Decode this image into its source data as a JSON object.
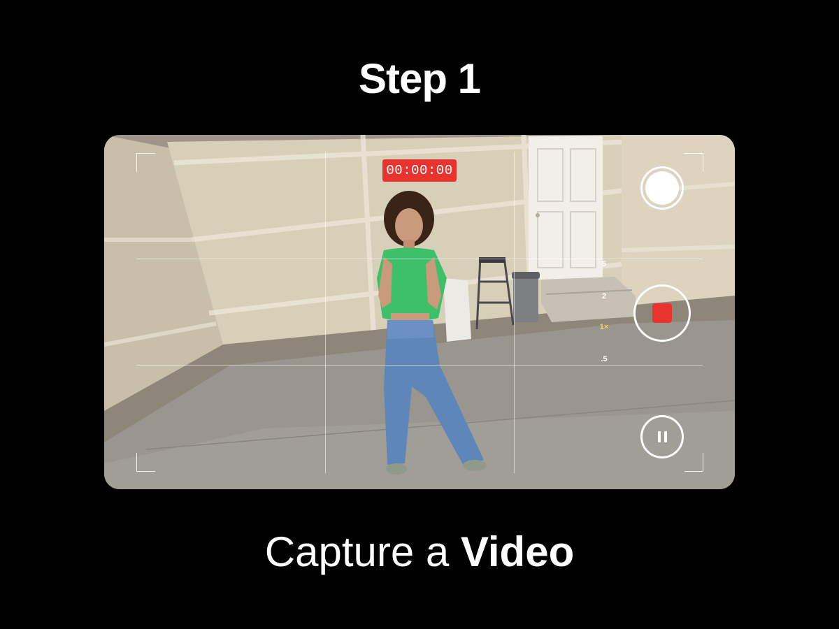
{
  "header": {
    "step_title": "Step 1"
  },
  "caption": {
    "prefix": "Capture a ",
    "emphasis": "Video"
  },
  "camera": {
    "timer": "00:00:00",
    "zoom_levels": [
      "5",
      "2",
      "1×",
      ".5"
    ],
    "active_zoom": "1×",
    "buttons": {
      "photo": "shutter-icon",
      "record": "stop-icon",
      "pause": "pause-icon"
    }
  },
  "colors": {
    "background": "#000000",
    "record_red": "#e8342e",
    "zoom_active": "#f3d44a",
    "text": "#ffffff"
  }
}
